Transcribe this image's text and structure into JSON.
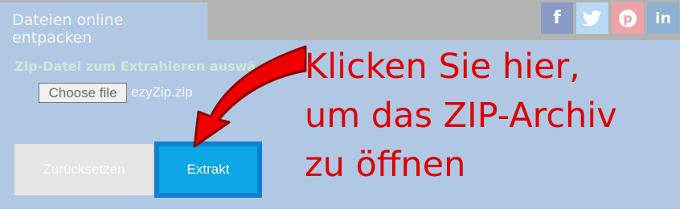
{
  "header": {
    "tab_title": "Dateien online entpacken",
    "social": [
      {
        "name": "facebook",
        "glyph": "f",
        "color": "#8c9bc6"
      },
      {
        "name": "twitter",
        "glyph": "twitter-bird",
        "color": "#b7d9f3"
      },
      {
        "name": "pinterest",
        "glyph": "p",
        "color": "#eea3a6"
      },
      {
        "name": "linkedin",
        "glyph": "in",
        "color": "#8cb1d1"
      }
    ]
  },
  "form": {
    "label": "Zip-Datei zum Extrahieren auswä",
    "choose_file_label": "Choose file",
    "file_name": "ezyZip.zip",
    "reset_label": "Zurücksetzen",
    "extract_label": "Extrakt"
  },
  "annotation": {
    "line1": "Klicken Sie hier,",
    "line2": "um das ZIP-Archiv",
    "line3": "zu öffnen",
    "color": "#e00000",
    "arrow_icon": "red-curved-arrow-icon"
  }
}
